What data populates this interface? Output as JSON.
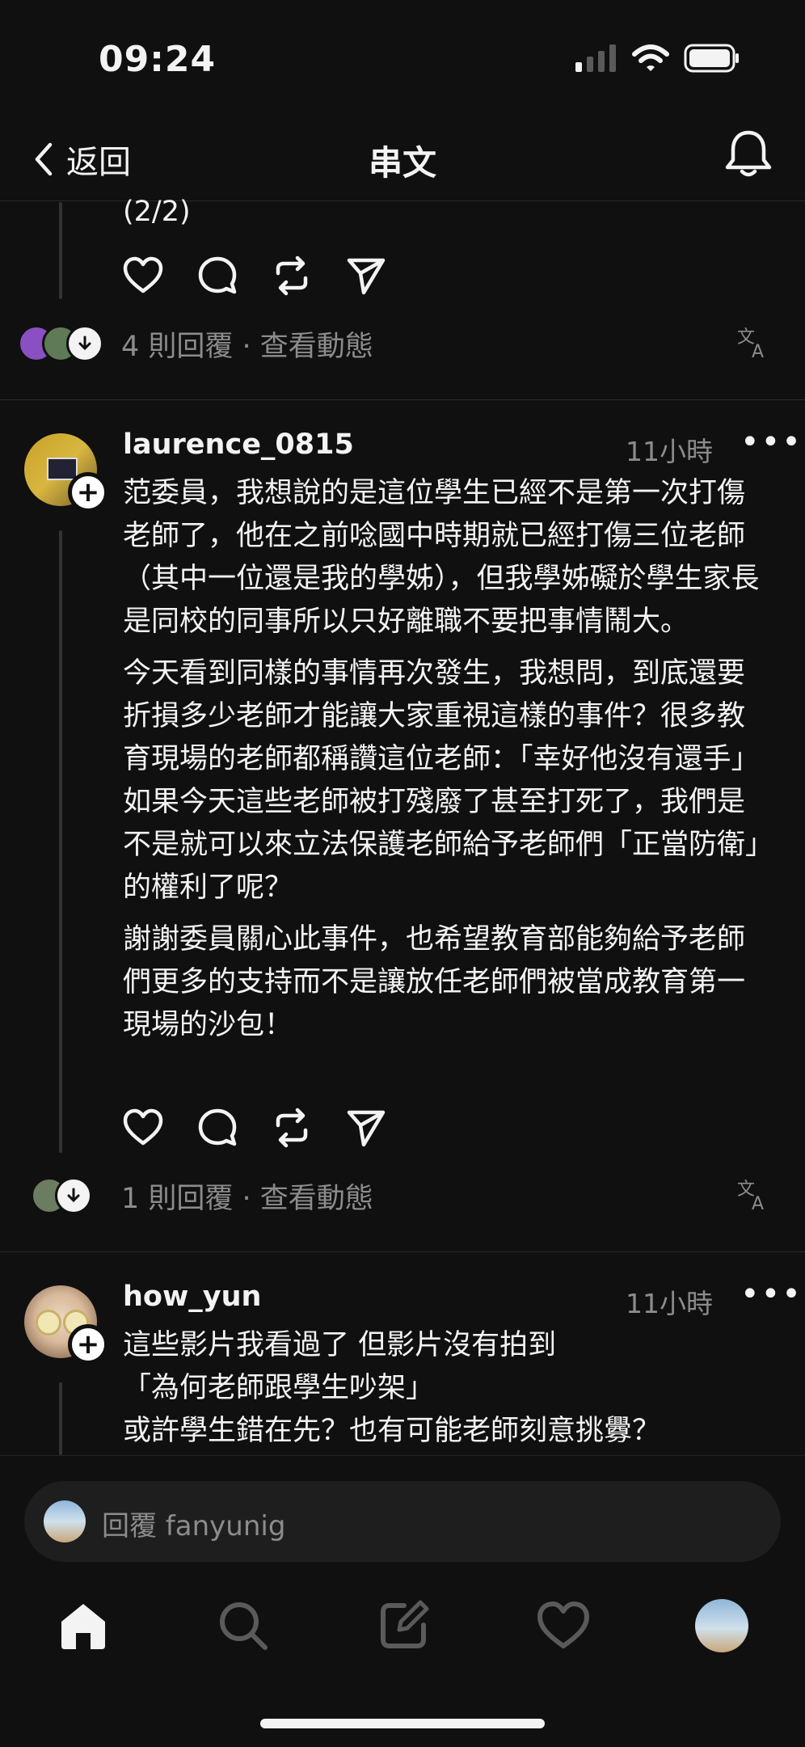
{
  "status_bar": {
    "time": "09:24"
  },
  "nav": {
    "back_label": "返回",
    "title": "串文"
  },
  "prev_post": {
    "text_tail": "(2/2)",
    "replies_text": "4 則回覆 · 查看動態"
  },
  "posts": [
    {
      "username": "laurence_0815",
      "time": "11小時",
      "paragraphs": [
        "范委員，我想說的是這位學生已經不是第一次打傷老師了，他在之前唸國中時期就已經打傷三位老師（其中一位還是我的學姊），但我學姊礙於學生家長是同校的同事所以只好離職不要把事情鬧大。",
        "今天看到同樣的事情再次發生，我想問，到底還要折損多少老師才能讓大家重視這樣的事件？很多教育現場的老師都稱讚這位老師：「幸好他沒有還手」如果今天這些老師被打殘廢了甚至打死了，我們是不是就可以來立法保護老師給予老師們「正當防衛」的權利了呢？",
        "謝謝委員關心此事件，也希望教育部能夠給予老師們更多的支持而不是讓放任老師們被當成教育第一現場的沙包！"
      ],
      "replies_text": "1 則回覆 · 查看動態"
    },
    {
      "username": "how_yun",
      "time": "11小時",
      "lines": [
        "這些影片我看過了 但影片沒有拍到",
        "「為何老師跟學生吵架」",
        "或許學生錯在先？也有可能老師刻意挑釁？"
      ]
    }
  ],
  "reply_bar": {
    "placeholder": "回覆 fanyunig"
  },
  "icons": {
    "back": "chevron-left-icon",
    "bell": "bell-icon",
    "like": "heart-icon",
    "comment": "comment-bubble-icon",
    "repost": "repost-icon",
    "share": "send-icon",
    "translate": "translate-icon",
    "more": "more-dots-icon",
    "home": "home-icon",
    "search": "search-icon",
    "compose": "compose-icon",
    "activity": "heart-icon",
    "profile": "avatar"
  },
  "colors": {
    "background": "#101010",
    "text": "#f3f3f3",
    "muted": "#8c8c8c"
  }
}
